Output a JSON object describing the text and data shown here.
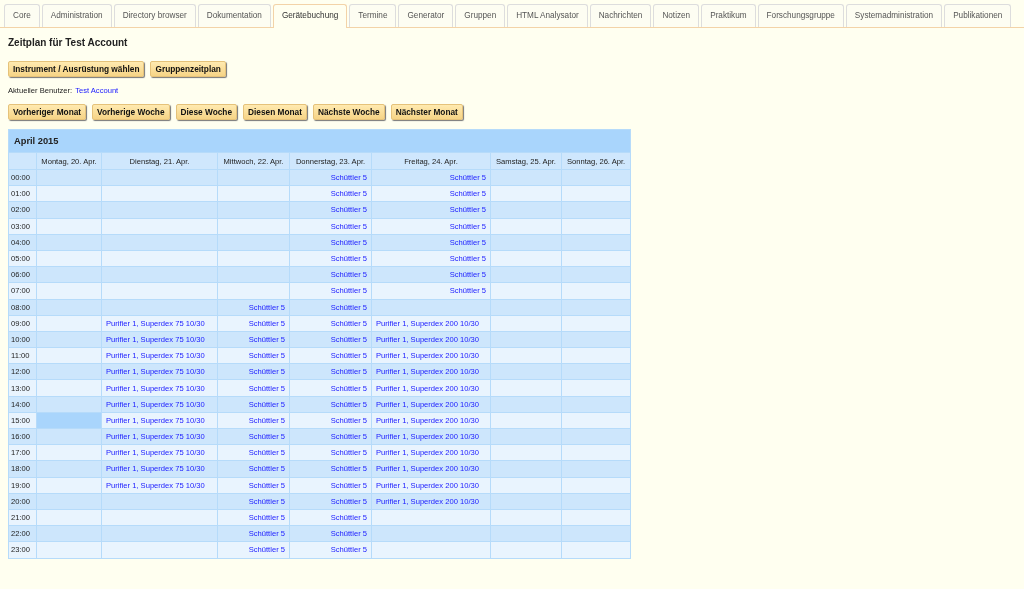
{
  "tabs": [
    {
      "label": "Core",
      "selected": false
    },
    {
      "label": "Administration",
      "selected": false
    },
    {
      "label": "Directory browser",
      "selected": false
    },
    {
      "label": "Dokumentation",
      "selected": false
    },
    {
      "label": "Gerätebuchung",
      "selected": true
    },
    {
      "label": "Termine",
      "selected": false
    },
    {
      "label": "Generator",
      "selected": false
    },
    {
      "label": "Gruppen",
      "selected": false
    },
    {
      "label": "HTML Analysator",
      "selected": false
    },
    {
      "label": "Nachrichten",
      "selected": false
    },
    {
      "label": "Notizen",
      "selected": false
    },
    {
      "label": "Praktikum",
      "selected": false
    },
    {
      "label": "Forschungsgruppe",
      "selected": false
    },
    {
      "label": "Systemadministration",
      "selected": false
    },
    {
      "label": "Publikationen",
      "selected": false
    }
  ],
  "title": "Zeitplan für Test Account",
  "top_buttons": [
    "Instrument / Ausrüstung wählen",
    "Gruppenzeitplan"
  ],
  "current_user": {
    "label": "Aktueller Benutzer:",
    "name": "Test Account"
  },
  "nav_buttons": [
    "Vorheriger Monat",
    "Vorherige Woche",
    "Diese Woche",
    "Diesen Monat",
    "Nächste Woche",
    "Nächster Monat"
  ],
  "schedule": {
    "month": "April 2015",
    "days": [
      "Montag, 20. Apr.",
      "Dienstag, 21. Apr.",
      "Mittwoch, 22. Apr.",
      "Donnerstag, 23. Apr.",
      "Freitag, 24. Apr.",
      "Samstag, 25. Apr.",
      "Sonntag, 26. Apr."
    ],
    "rows": [
      {
        "time": "00:00",
        "cells": [
          {
            "selected": false
          },
          {
            "selected": false
          },
          {
            "selected": false
          },
          {
            "text": "Schüttler 5",
            "kind": "shaker",
            "selected": false
          },
          {
            "text": "Schüttler 5",
            "kind": "shaker",
            "selected": false
          },
          {
            "selected": false
          },
          {
            "selected": false
          }
        ]
      },
      {
        "time": "01:00",
        "cells": [
          {
            "selected": false
          },
          {
            "selected": false
          },
          {
            "selected": false
          },
          {
            "text": "Schüttler 5",
            "kind": "shaker",
            "selected": false
          },
          {
            "text": "Schüttler 5",
            "kind": "shaker",
            "selected": false
          },
          {
            "selected": false
          },
          {
            "selected": false
          }
        ]
      },
      {
        "time": "02:00",
        "cells": [
          {
            "selected": false
          },
          {
            "selected": false
          },
          {
            "selected": false
          },
          {
            "text": "Schüttler 5",
            "kind": "shaker",
            "selected": false
          },
          {
            "text": "Schüttler 5",
            "kind": "shaker",
            "selected": false
          },
          {
            "selected": false
          },
          {
            "selected": false
          }
        ]
      },
      {
        "time": "03:00",
        "cells": [
          {
            "selected": false
          },
          {
            "selected": false
          },
          {
            "selected": false
          },
          {
            "text": "Schüttler 5",
            "kind": "shaker",
            "selected": false
          },
          {
            "text": "Schüttler 5",
            "kind": "shaker",
            "selected": false
          },
          {
            "selected": false
          },
          {
            "selected": false
          }
        ]
      },
      {
        "time": "04:00",
        "cells": [
          {
            "selected": false
          },
          {
            "selected": false
          },
          {
            "selected": false
          },
          {
            "text": "Schüttler 5",
            "kind": "shaker",
            "selected": false
          },
          {
            "text": "Schüttler 5",
            "kind": "shaker",
            "selected": false
          },
          {
            "selected": false
          },
          {
            "selected": false
          }
        ]
      },
      {
        "time": "05:00",
        "cells": [
          {
            "selected": false
          },
          {
            "selected": false
          },
          {
            "selected": false
          },
          {
            "text": "Schüttler 5",
            "kind": "shaker",
            "selected": false
          },
          {
            "text": "Schüttler 5",
            "kind": "shaker",
            "selected": false
          },
          {
            "selected": false
          },
          {
            "selected": false
          }
        ]
      },
      {
        "time": "06:00",
        "cells": [
          {
            "selected": false
          },
          {
            "selected": false
          },
          {
            "selected": false
          },
          {
            "text": "Schüttler 5",
            "kind": "shaker",
            "selected": false
          },
          {
            "text": "Schüttler 5",
            "kind": "shaker",
            "selected": false
          },
          {
            "selected": false
          },
          {
            "selected": false
          }
        ]
      },
      {
        "time": "07:00",
        "cells": [
          {
            "selected": false
          },
          {
            "selected": false
          },
          {
            "selected": false
          },
          {
            "text": "Schüttler 5",
            "kind": "shaker",
            "selected": false
          },
          {
            "text": "Schüttler 5",
            "kind": "shaker",
            "selected": false
          },
          {
            "selected": false
          },
          {
            "selected": false
          }
        ]
      },
      {
        "time": "08:00",
        "cells": [
          {
            "selected": false
          },
          {
            "selected": false
          },
          {
            "text": "Schüttler 5",
            "kind": "shaker",
            "selected": false
          },
          {
            "text": "Schüttler 5",
            "kind": "shaker",
            "selected": false
          },
          {
            "selected": false
          },
          {
            "selected": false
          },
          {
            "selected": false
          }
        ]
      },
      {
        "time": "09:00",
        "cells": [
          {
            "selected": false
          },
          {
            "text": "Purifier 1, Superdex 75 10/30",
            "kind": "purifier",
            "selected": false
          },
          {
            "text": "Schüttler 5",
            "kind": "shaker",
            "selected": false
          },
          {
            "text": "Schüttler 5",
            "kind": "shaker",
            "selected": false
          },
          {
            "text": "Purifier 1, Superdex 200 10/30",
            "kind": "purifier",
            "selected": false
          },
          {
            "selected": false
          },
          {
            "selected": false
          }
        ]
      },
      {
        "time": "10:00",
        "cells": [
          {
            "selected": false
          },
          {
            "text": "Purifier 1, Superdex 75 10/30",
            "kind": "purifier",
            "selected": false
          },
          {
            "text": "Schüttler 5",
            "kind": "shaker",
            "selected": false
          },
          {
            "text": "Schüttler 5",
            "kind": "shaker",
            "selected": false
          },
          {
            "text": "Purifier 1, Superdex 200 10/30",
            "kind": "purifier",
            "selected": false
          },
          {
            "selected": false
          },
          {
            "selected": false
          }
        ]
      },
      {
        "time": "11:00",
        "cells": [
          {
            "selected": false
          },
          {
            "text": "Purifier 1, Superdex 75 10/30",
            "kind": "purifier",
            "selected": false
          },
          {
            "text": "Schüttler 5",
            "kind": "shaker",
            "selected": false
          },
          {
            "text": "Schüttler 5",
            "kind": "shaker",
            "selected": false
          },
          {
            "text": "Purifier 1, Superdex 200 10/30",
            "kind": "purifier",
            "selected": false
          },
          {
            "selected": false
          },
          {
            "selected": false
          }
        ]
      },
      {
        "time": "12:00",
        "cells": [
          {
            "selected": false
          },
          {
            "text": "Purifier 1, Superdex 75 10/30",
            "kind": "purifier",
            "selected": false
          },
          {
            "text": "Schüttler 5",
            "kind": "shaker",
            "selected": false
          },
          {
            "text": "Schüttler 5",
            "kind": "shaker",
            "selected": false
          },
          {
            "text": "Purifier 1, Superdex 200 10/30",
            "kind": "purifier",
            "selected": false
          },
          {
            "selected": false
          },
          {
            "selected": false
          }
        ]
      },
      {
        "time": "13:00",
        "cells": [
          {
            "selected": false
          },
          {
            "text": "Purifier 1, Superdex 75 10/30",
            "kind": "purifier",
            "selected": false
          },
          {
            "text": "Schüttler 5",
            "kind": "shaker",
            "selected": false
          },
          {
            "text": "Schüttler 5",
            "kind": "shaker",
            "selected": false
          },
          {
            "text": "Purifier 1, Superdex 200 10/30",
            "kind": "purifier",
            "selected": false
          },
          {
            "selected": false
          },
          {
            "selected": false
          }
        ]
      },
      {
        "time": "14:00",
        "cells": [
          {
            "selected": false
          },
          {
            "text": "Purifier 1, Superdex 75 10/30",
            "kind": "purifier",
            "selected": false
          },
          {
            "text": "Schüttler 5",
            "kind": "shaker",
            "selected": false
          },
          {
            "text": "Schüttler 5",
            "kind": "shaker",
            "selected": false
          },
          {
            "text": "Purifier 1, Superdex 200 10/30",
            "kind": "purifier",
            "selected": false
          },
          {
            "selected": false
          },
          {
            "selected": false
          }
        ]
      },
      {
        "time": "15:00",
        "cells": [
          {
            "selected": true
          },
          {
            "text": "Purifier 1, Superdex 75 10/30",
            "kind": "purifier",
            "selected": false
          },
          {
            "text": "Schüttler 5",
            "kind": "shaker",
            "selected": false
          },
          {
            "text": "Schüttler 5",
            "kind": "shaker",
            "selected": false
          },
          {
            "text": "Purifier 1, Superdex 200 10/30",
            "kind": "purifier",
            "selected": false
          },
          {
            "selected": false
          },
          {
            "selected": false
          }
        ]
      },
      {
        "time": "16:00",
        "cells": [
          {
            "selected": false
          },
          {
            "text": "Purifier 1, Superdex 75 10/30",
            "kind": "purifier",
            "selected": false
          },
          {
            "text": "Schüttler 5",
            "kind": "shaker",
            "selected": false
          },
          {
            "text": "Schüttler 5",
            "kind": "shaker",
            "selected": false
          },
          {
            "text": "Purifier 1, Superdex 200 10/30",
            "kind": "purifier",
            "selected": false
          },
          {
            "selected": false
          },
          {
            "selected": false
          }
        ]
      },
      {
        "time": "17:00",
        "cells": [
          {
            "selected": false
          },
          {
            "text": "Purifier 1, Superdex 75 10/30",
            "kind": "purifier",
            "selected": false
          },
          {
            "text": "Schüttler 5",
            "kind": "shaker",
            "selected": false
          },
          {
            "text": "Schüttler 5",
            "kind": "shaker",
            "selected": false
          },
          {
            "text": "Purifier 1, Superdex 200 10/30",
            "kind": "purifier",
            "selected": false
          },
          {
            "selected": false
          },
          {
            "selected": false
          }
        ]
      },
      {
        "time": "18:00",
        "cells": [
          {
            "selected": false
          },
          {
            "text": "Purifier 1, Superdex 75 10/30",
            "kind": "purifier",
            "selected": false
          },
          {
            "text": "Schüttler 5",
            "kind": "shaker",
            "selected": false
          },
          {
            "text": "Schüttler 5",
            "kind": "shaker",
            "selected": false
          },
          {
            "text": "Purifier 1, Superdex 200 10/30",
            "kind": "purifier",
            "selected": false
          },
          {
            "selected": false
          },
          {
            "selected": false
          }
        ]
      },
      {
        "time": "19:00",
        "cells": [
          {
            "selected": false
          },
          {
            "text": "Purifier 1, Superdex 75 10/30",
            "kind": "purifier",
            "selected": false
          },
          {
            "text": "Schüttler 5",
            "kind": "shaker",
            "selected": false
          },
          {
            "text": "Schüttler 5",
            "kind": "shaker",
            "selected": false
          },
          {
            "text": "Purifier 1, Superdex 200 10/30",
            "kind": "purifier",
            "selected": false
          },
          {
            "selected": false
          },
          {
            "selected": false
          }
        ]
      },
      {
        "time": "20:00",
        "cells": [
          {
            "selected": false
          },
          {
            "selected": false
          },
          {
            "text": "Schüttler 5",
            "kind": "shaker",
            "selected": false
          },
          {
            "text": "Schüttler 5",
            "kind": "shaker",
            "selected": false
          },
          {
            "text": "Purifier 1, Superdex 200 10/30",
            "kind": "purifier",
            "selected": false
          },
          {
            "selected": false
          },
          {
            "selected": false
          }
        ]
      },
      {
        "time": "21:00",
        "cells": [
          {
            "selected": false
          },
          {
            "selected": false
          },
          {
            "text": "Schüttler 5",
            "kind": "shaker",
            "selected": false
          },
          {
            "text": "Schüttler 5",
            "kind": "shaker",
            "selected": false
          },
          {
            "selected": false
          },
          {
            "selected": false
          },
          {
            "selected": false
          }
        ]
      },
      {
        "time": "22:00",
        "cells": [
          {
            "selected": false
          },
          {
            "selected": false
          },
          {
            "text": "Schüttler 5",
            "kind": "shaker",
            "selected": false
          },
          {
            "text": "Schüttler 5",
            "kind": "shaker",
            "selected": false
          },
          {
            "selected": false
          },
          {
            "selected": false
          },
          {
            "selected": false
          }
        ]
      },
      {
        "time": "23:00",
        "cells": [
          {
            "selected": false
          },
          {
            "selected": false
          },
          {
            "text": "Schüttler 5",
            "kind": "shaker",
            "selected": false
          },
          {
            "text": "Schüttler 5",
            "kind": "shaker",
            "selected": false
          },
          {
            "selected": false
          },
          {
            "selected": false
          },
          {
            "selected": false
          }
        ]
      }
    ]
  }
}
